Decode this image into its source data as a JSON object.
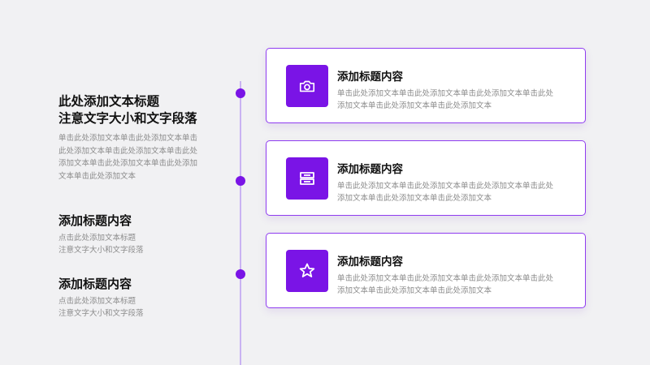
{
  "left": {
    "title_line1": "此处添加文本标题",
    "title_line2": "注意文字大小和文字段落",
    "body_lines": [
      "单击此处添加文本单击此处添加文本单击",
      "此处添加文本单击此处添加文本单击此处",
      "添加文本单击此处添加文本单击此处添加",
      "文本单击此处添加文本"
    ],
    "sections": [
      {
        "title": "添加标题内容",
        "line1": "点击此处添加文本标题",
        "line2": "注意文字大小和文字段落"
      },
      {
        "title": "添加标题内容",
        "line1": "点击此处添加文本标题",
        "line2": "注意文字大小和文字段落"
      }
    ]
  },
  "cards": [
    {
      "icon": "camera-icon",
      "title": "添加标题内容",
      "line1": "单击此处添加文本单击此处添加文本单击此处添加文本单击此处",
      "line2": "添加文本单击此处添加文本单击此处添加文本"
    },
    {
      "icon": "ticket-icon",
      "title": "添加标题内容",
      "line1": "单击此处添加文本单击此处添加文本单击此处添加文本单击此处",
      "line2": "添加文本单击此处添加文本单击此处添加文本"
    },
    {
      "icon": "star-icon",
      "title": "添加标题内容",
      "line1": "单击此处添加文本单击此处添加文本单击此处添加文本单击此处",
      "line2": "添加文本单击此处添加文本单击此处添加文本"
    }
  ],
  "colors": {
    "accent": "#7a14e6",
    "card_border": "#8f3cf0",
    "background": "#f1f1f3"
  }
}
